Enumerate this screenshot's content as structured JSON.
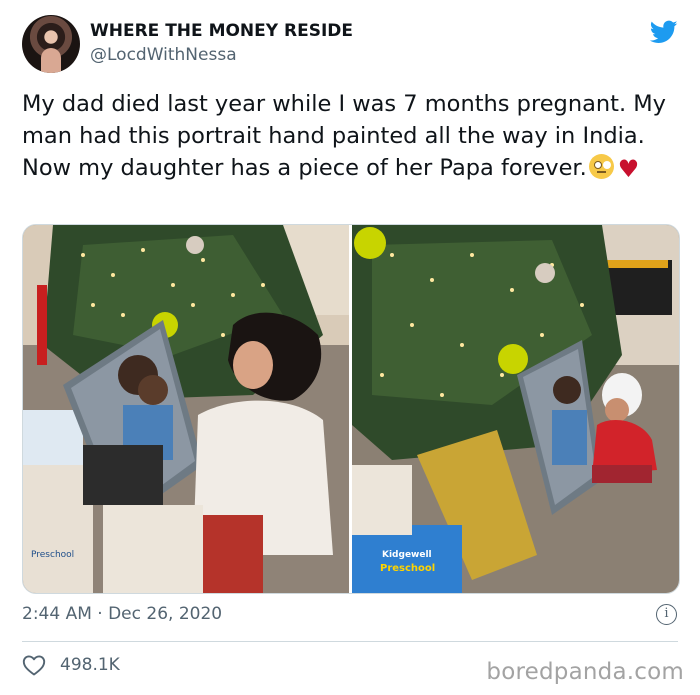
{
  "tweet": {
    "display_name": "WHERE THE MONEY RESIDE",
    "handle": "@LocdWithNessa",
    "text": "My dad died last year while I was 7 months pregnant. My man had this portrait hand painted all the way in India. Now my daughter has a piece of her Papa forever.",
    "emojis": [
      "face-with-rolling-eyes",
      "red-heart"
    ],
    "timestamp": "2:44 AM · Dec 26, 2020",
    "likes": "498.1K"
  },
  "photos": {
    "left_package_label": "Preschool",
    "right_package_brand": "Kidgewell",
    "right_package_label": "Preschool"
  },
  "watermark": "boredpanda.com",
  "colors": {
    "twitter_blue": "#1d9bf0",
    "text_primary": "#0f1419",
    "text_secondary": "#536471",
    "heart_red": "#c8102e"
  }
}
